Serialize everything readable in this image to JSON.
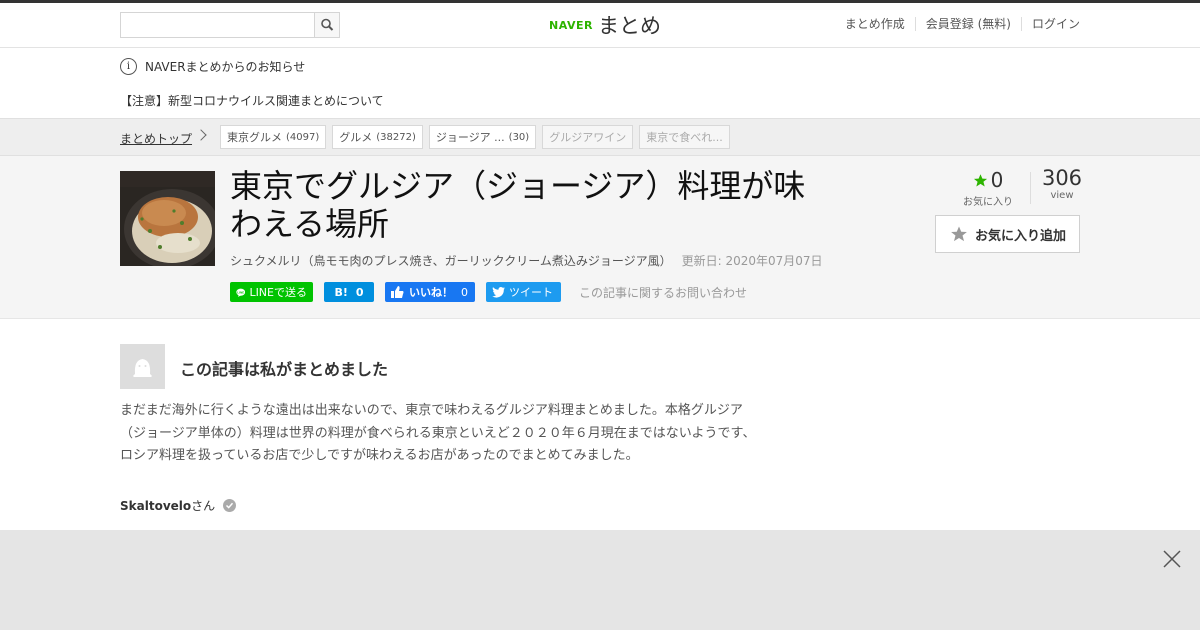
{
  "header": {
    "search": {
      "placeholder": "",
      "value": "",
      "button_icon": "search-icon"
    },
    "logo": {
      "brand": "NAVER",
      "service": "まとめ"
    },
    "nav": [
      "まとめ作成",
      "会員登録 (無料)",
      "ログイン"
    ]
  },
  "notice": {
    "title": "NAVERまとめからのお知らせ",
    "item": "【注意】新型コロナウイルス関連まとめについて"
  },
  "breadcrumb": {
    "top": "まとめトップ",
    "tags": [
      {
        "label": "東京グルメ",
        "count": "(4097)"
      },
      {
        "label": "グルメ",
        "count": "(38272)"
      },
      {
        "label": "ジョージア ...",
        "count": "(30)"
      },
      {
        "label": "グルジアワイン",
        "count": ""
      },
      {
        "label": "東京で食べれ...",
        "count": ""
      }
    ]
  },
  "article": {
    "title": "東京でグルジア（ジョージア）料理が味わえる場所",
    "subtitle": "シュクメルリ（鳥モモ肉のプレス焼き、ガーリッククリーム煮込みジョージア風）",
    "updated": "更新日: 2020年07月07日",
    "favorites": {
      "count": "0",
      "label": "お気に入り"
    },
    "views": {
      "count": "306",
      "label": "view"
    },
    "fav_button": "お気に入り追加",
    "social": {
      "line": "LINEで送る",
      "hatena_mark": "B!",
      "hatena_count": "0",
      "facebook": "いいね！",
      "facebook_count": "0",
      "twitter": "ツイート",
      "inquiry": "この記事に関するお問い合わせ"
    }
  },
  "author": {
    "heading": "この記事は私がまとめました",
    "description": "まだまだ海外に行くような遠出は出来ないので、東京で味わえるグルジア料理まとめました。本格グルジア（ジョージア単体の）料理は世界の料理が食べられる東京といえど２０２０年６月現在まではないようです、ロシア料理を扱っているお店で少しですが味わえるお店があったのでまとめてみました。",
    "name": "Skaltovelo",
    "suffix": "さん"
  },
  "colors": {
    "naver_green": "#2db400",
    "line": "#00c300",
    "hatena": "#008fde",
    "facebook": "#1877f2",
    "twitter": "#1d9bf0"
  }
}
